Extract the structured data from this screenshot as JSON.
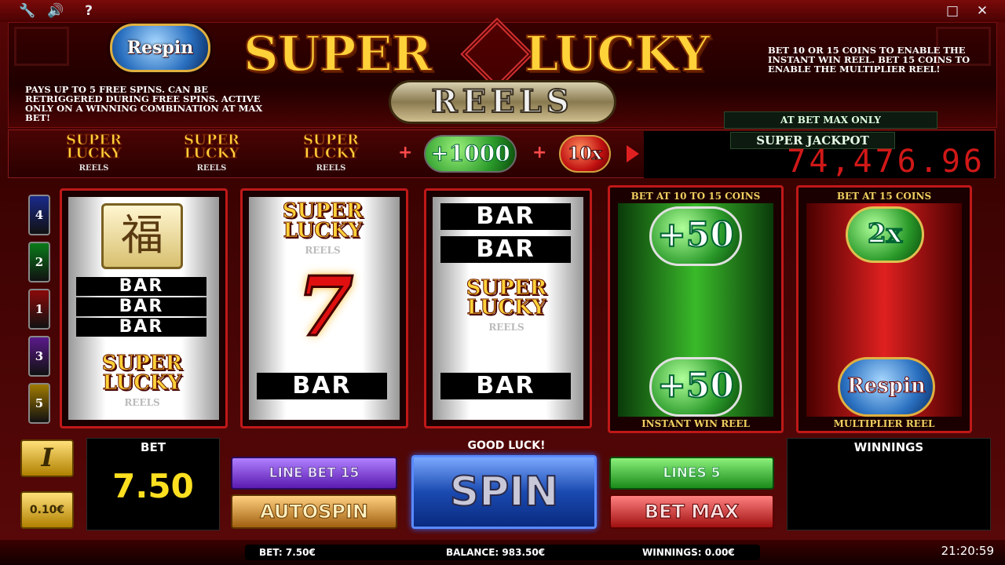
{
  "game": {
    "respin_badge": "Respin",
    "respin_info": "PAYS UP TO 5 FREE SPINS. CAN BE RETRIGGERED DURING FREE SPINS. ACTIVE ONLY ON A WINNING COMBINATION AT MAX BET!",
    "logo_super": "SUPER",
    "logo_lucky": "LUCKY",
    "logo_reels": "REELS",
    "bet_info": "BET 10 OR 15 COINS TO ENABLE THE INSTANT WIN REEL. BET 15 COINS TO ENABLE THE MULTIPLIER REEL!",
    "bet_max_only": "AT BET MAX ONLY"
  },
  "paytable": {
    "mini_logo_super": "SUPER",
    "mini_logo_lucky": "LUCKY",
    "mini_logo_reels": "REELS",
    "plus": "+",
    "bonus_value": "+1000",
    "multiplier": "10x"
  },
  "jackpot": {
    "label": "SUPER JACKPOT",
    "value": "74,476.96"
  },
  "paylines": [
    "4",
    "2",
    "1",
    "3",
    "5"
  ],
  "paylines_colors": [
    "#1a2a8a",
    "#0a7a1a",
    "#8a0a0a",
    "#5a1a8a",
    "#a07a00"
  ],
  "reels": {
    "fu_symbol": "福",
    "bar": "BAR",
    "seven": "7",
    "logo_super": "SUPER",
    "logo_lucky": "LUCKY",
    "logo_reels": "REELS"
  },
  "instant_reel": {
    "header": "BET AT 10 TO 15 COINS",
    "top_value": "+50",
    "bottom_value": "+50",
    "caption": "INSTANT WIN REEL"
  },
  "multiplier_reel": {
    "header": "BET AT 15 COINS",
    "top_value": "2x",
    "bottom_value": "Respin",
    "caption": "MULTIPLIER REEL"
  },
  "controls": {
    "info": "i",
    "coin_value": "0.10€",
    "bet_label": "BET",
    "bet_value": "7.50",
    "line_bet": "LINE BET 15",
    "autospin": "AUTOSPIN",
    "good_luck": "GOOD LUCK!",
    "spin": "SPIN",
    "lines": "LINES 5",
    "bet_max": "BET MAX",
    "winnings_label": "WINNINGS"
  },
  "status": {
    "bet": "BET: 7.50€",
    "balance": "BALANCE: 983.50€",
    "winnings": "WINNINGS: 0.00€",
    "clock": "21:20:59"
  },
  "topbar": {
    "wrench_icon": "🔧",
    "speaker_icon": "🔊",
    "help_icon": "?",
    "maximize_icon": "□",
    "close_icon": "✕"
  }
}
